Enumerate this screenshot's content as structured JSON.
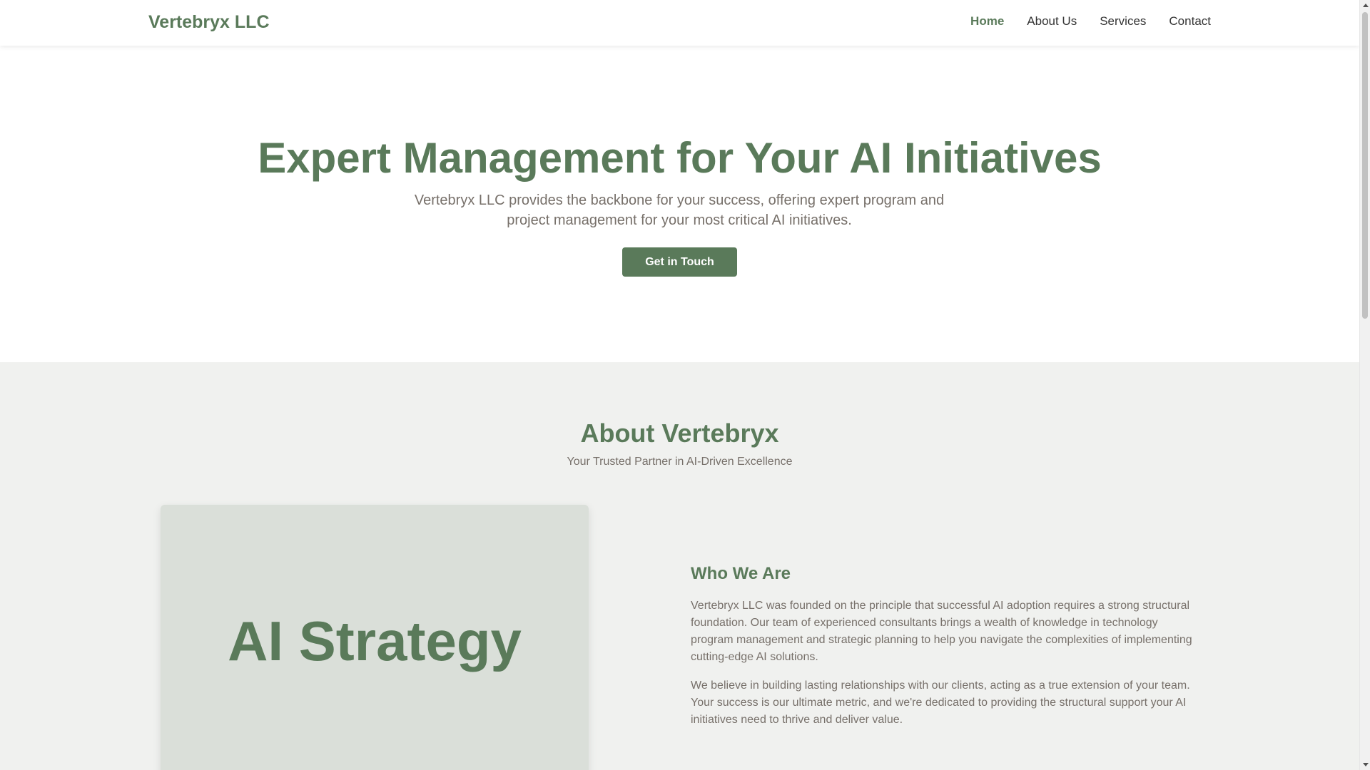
{
  "header": {
    "logo": "Vertebryx LLC",
    "nav": [
      {
        "label": "Home",
        "active": true
      },
      {
        "label": "About Us",
        "active": false
      },
      {
        "label": "Services",
        "active": false
      },
      {
        "label": "Contact",
        "active": false
      }
    ]
  },
  "hero": {
    "title": "Expert Management for Your AI Initiatives",
    "description": "Vertebryx LLC provides the backbone for your success, offering expert program and project management for your most critical AI initiatives.",
    "cta_label": "Get in Touch"
  },
  "about": {
    "title": "About Vertebryx",
    "subtitle": "Your Trusted Partner in AI-Driven Excellence",
    "image_text": "AI Strategy",
    "who_title": "Who We Are",
    "paragraphs": [
      "Vertebryx LLC was founded on the principle that successful AI adoption requires a strong structural foundation. Our team of experienced consultants brings a wealth of knowledge in technology program management and strategic planning to help you navigate the complexities of implementing cutting-edge AI solutions.",
      "We believe in building lasting relationships with our clients, acting as a true extension of your team. Your success is our ultimate metric, and we're dedicated to providing the structural support your AI initiatives need to thrive and deliver value."
    ]
  },
  "colors": {
    "brand": "#5a7a5a",
    "muted_text": "#77706a",
    "section_bg": "#f0f1ef",
    "card_bg": "#dadfd9"
  }
}
